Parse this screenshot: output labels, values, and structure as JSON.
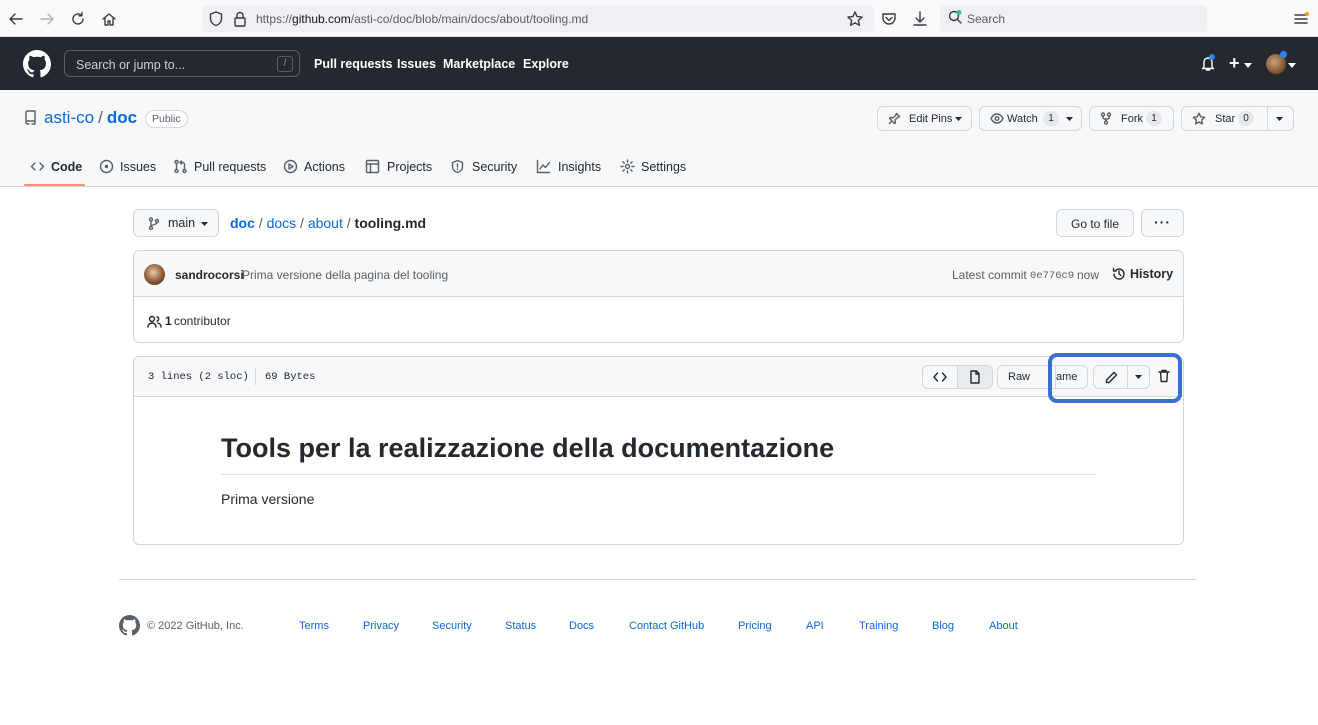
{
  "browser": {
    "url_prefix": "https://",
    "url_domain": "github.com",
    "url_path": "/asti-co/doc/blob/main/docs/about/tooling.md",
    "search_placeholder": "Search"
  },
  "gh_header": {
    "search_placeholder": "Search or jump to...",
    "search_shortcut": "/",
    "nav": [
      "Pull requests",
      "Issues",
      "Marketplace",
      "Explore"
    ],
    "new_menu": "+"
  },
  "repo": {
    "owner": "asti-co",
    "separator": "/",
    "name": "doc",
    "visibility": "Public",
    "edit_pins": "Edit Pins",
    "watch": "Watch",
    "watch_count": "1",
    "fork": "Fork",
    "fork_count": "1",
    "star": "Star",
    "star_count": "0"
  },
  "tabs": [
    {
      "label": "Code",
      "icon": "code-icon"
    },
    {
      "label": "Issues",
      "icon": "issue-icon"
    },
    {
      "label": "Pull requests",
      "icon": "pull-request-icon"
    },
    {
      "label": "Actions",
      "icon": "play-icon"
    },
    {
      "label": "Projects",
      "icon": "table-icon"
    },
    {
      "label": "Security",
      "icon": "shield-icon"
    },
    {
      "label": "Insights",
      "icon": "graph-icon"
    },
    {
      "label": "Settings",
      "icon": "gear-icon"
    }
  ],
  "filenav": {
    "branch": "main",
    "path": [
      "doc",
      "docs",
      "about"
    ],
    "sep": "/",
    "file": "tooling.md",
    "go_to_file": "Go to file",
    "more": "···"
  },
  "commit": {
    "author": "sandrocorsi",
    "message": "Prima versione della pagina del tooling",
    "latest_label": "Latest commit",
    "sha": "0e776c9",
    "when": "now",
    "history": "History",
    "contributors_count": "1",
    "contributors_label": "contributor"
  },
  "file": {
    "lines": "3 lines (2 sloc)",
    "size": "69 Bytes",
    "raw": "Raw",
    "blame": "ame",
    "heading": "Tools per la realizzazione della documentazione",
    "paragraph": "Prima versione"
  },
  "footer": {
    "copyright": "© 2022 GitHub, Inc.",
    "links": [
      "Terms",
      "Privacy",
      "Security",
      "Status",
      "Docs",
      "Contact GitHub",
      "Pricing",
      "API",
      "Training",
      "Blog",
      "About"
    ]
  },
  "colors": {
    "accent": "#0969da",
    "header_bg": "#24292f",
    "tab_underline": "#fd8c73",
    "highlight": "#3c6fd6"
  }
}
